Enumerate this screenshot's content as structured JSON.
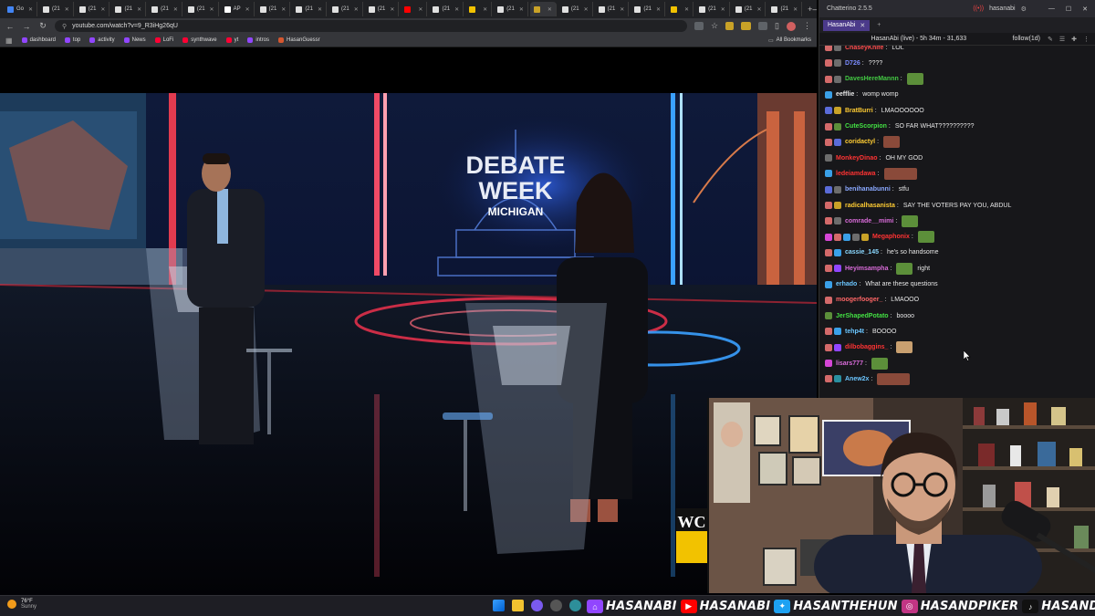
{
  "browser": {
    "tabs": [
      {
        "label": "Go",
        "color": "#4285f4"
      },
      {
        "label": "(21",
        "color": "#e0e0e0",
        "glyph": "X"
      },
      {
        "label": "(21",
        "color": "#e0e0e0",
        "glyph": "X"
      },
      {
        "label": "(21",
        "color": "#e0e0e0",
        "glyph": "X"
      },
      {
        "label": "(21",
        "color": "#e0e0e0",
        "glyph": "X"
      },
      {
        "label": "(21",
        "color": "#e0e0e0",
        "glyph": "X"
      },
      {
        "label": "AP",
        "color": "#ffffff",
        "glyph": "AP"
      },
      {
        "label": "(21",
        "color": "#e0e0e0",
        "glyph": "X"
      },
      {
        "label": "(21",
        "color": "#e0e0e0",
        "glyph": "X"
      },
      {
        "label": "(21",
        "color": "#e0e0e0",
        "glyph": "X"
      },
      {
        "label": "(21",
        "color": "#e0e0e0",
        "glyph": "X"
      },
      {
        "label": "",
        "color": "#ff0000",
        "glyph": "▶"
      },
      {
        "label": "(21",
        "color": "#e0e0e0",
        "glyph": "X"
      },
      {
        "label": "",
        "color": "#f2c200"
      },
      {
        "label": "(21",
        "color": "#e0e0e0",
        "glyph": "X"
      },
      {
        "label": "",
        "color": "#c9a227",
        "active": true
      },
      {
        "label": "(21",
        "color": "#e0e0e0",
        "glyph": "X"
      },
      {
        "label": "(21",
        "color": "#e0e0e0",
        "glyph": "X"
      },
      {
        "label": "(21",
        "color": "#e0e0e0",
        "glyph": "X"
      },
      {
        "label": "",
        "color": "#f2c200"
      },
      {
        "label": "(21",
        "color": "#e0e0e0",
        "glyph": "X"
      },
      {
        "label": "(21",
        "color": "#e0e0e0",
        "glyph": "X"
      },
      {
        "label": "(21",
        "color": "#e0e0e0",
        "glyph": "X"
      }
    ],
    "url": "youtube.com/watch?v=9_R3iHg26qU",
    "bookmarks": [
      {
        "label": "dashboard",
        "color": "#9146ff"
      },
      {
        "label": "top",
        "color": "#9146ff"
      },
      {
        "label": "activity",
        "color": "#9146ff"
      },
      {
        "label": "News",
        "color": "#9146ff"
      },
      {
        "label": "LoFi",
        "color": "#ff0033"
      },
      {
        "label": "synthwave",
        "color": "#ff0033"
      },
      {
        "label": "yt",
        "color": "#ff0033"
      },
      {
        "label": "intros",
        "color": "#9146ff"
      },
      {
        "label": "HasanGuessr",
        "color": "#d6572f"
      }
    ],
    "all_bookmarks": "All Bookmarks"
  },
  "video": {
    "headline_line1": "DEBATE",
    "headline_line2": "WEEK",
    "headline_state": "MICHIGAN",
    "watermark": "WC"
  },
  "chat": {
    "app_title": "Chatterino 2.5.5",
    "account": "hasanabi",
    "tab_label": "HasanAbi",
    "stream_info": "HasanAbi (live) - 5h 34m - 31,633",
    "follow": "follow(1d)",
    "messages": [
      {
        "user": "ChaseyKnife",
        "color": "#ff4d4d",
        "text": "LOL",
        "badges": [
          "#d46a6a",
          "#6d6d6d"
        ]
      },
      {
        "user": "D726",
        "color": "#7b8cff",
        "text": "????",
        "badges": [
          "#d46a6a",
          "#6d6d6d"
        ]
      },
      {
        "user": "DavesHereMannn",
        "color": "#43c943",
        "text": "",
        "badges": [
          "#d46a6a",
          "#6d6d6d"
        ],
        "emote": "#5c8f3a"
      },
      {
        "user": "eefflie",
        "color": "#e6e6e6",
        "text": "womp womp",
        "badges": [
          "#3aa0e8"
        ]
      },
      {
        "user": "BratBurri",
        "color": "#ffcc33",
        "text": "LMAOOOOOO",
        "badges": [
          "#5a6bd8",
          "#c9a227"
        ]
      },
      {
        "user": "CuteScorpion",
        "color": "#43e043",
        "text": "SO FAR WHAT??????????",
        "badges": [
          "#d46a6a",
          "#5c8f3a"
        ]
      },
      {
        "user": "coridactyl",
        "color": "#ffcc33",
        "text": "",
        "badges": [
          "#d46a6a",
          "#5a6bd8"
        ],
        "emote": "#8a4a3a"
      },
      {
        "user": "MonkeyDinao",
        "color": "#ff3333",
        "text": "OH MY GOD",
        "badges": [
          "#6d6d6d"
        ]
      },
      {
        "user": "ledeiamdawa",
        "color": "#ff3333",
        "text": "",
        "badges": [
          "#3aa0e8"
        ],
        "emote": "#8a4a3a",
        "emote_w": 36
      },
      {
        "user": "benihanabunni",
        "color": "#8aa8ff",
        "text": "stfu",
        "badges": [
          "#5a6bd8",
          "#6d6d6d"
        ]
      },
      {
        "user": "radicalhasanista",
        "color": "#ffcc33",
        "text": "SAY THE VOTERS PAY YOU, ABDUL",
        "badges": [
          "#d46a6a",
          "#c9a227"
        ]
      },
      {
        "user": "comrade__mimi",
        "color": "#d86bd8",
        "text": "",
        "badges": [
          "#d46a6a",
          "#6d6d6d"
        ],
        "emote": "#5c8f3a"
      },
      {
        "user": "Megaphonix",
        "color": "#ff3333",
        "text": "",
        "badges": [
          "#d646d6",
          "#d46a6a",
          "#3aa0e8",
          "#6d6d6d",
          "#c9a227"
        ],
        "emote": "#5c8f3a"
      },
      {
        "user": "cassie_145",
        "color": "#8ad8ff",
        "text": "he's so handsome",
        "badges": [
          "#d46a6a",
          "#3aa0e8"
        ]
      },
      {
        "user": "Heyimsampha",
        "color": "#d86bd8",
        "text": "right",
        "badges": [
          "#d46a6a",
          "#9146ff"
        ],
        "emote": "#5c8f3a",
        "emote_before_text": true
      },
      {
        "user": "erhado",
        "color": "#6bc6ff",
        "text": "What are these questions",
        "badges": [
          "#3aa0e8"
        ]
      },
      {
        "user": "moogerfooger_",
        "color": "#ff6666",
        "text": "LMAOOO",
        "badges": [
          "#d46a6a"
        ]
      },
      {
        "user": "JerShapedPotato",
        "color": "#43e043",
        "text": "boooo",
        "badges": [
          "#5c8f3a"
        ]
      },
      {
        "user": "tehp4t",
        "color": "#6bc6ff",
        "text": "BOOOO",
        "badges": [
          "#d46a6a",
          "#3aa0e8"
        ]
      },
      {
        "user": "dilbobaggins_",
        "color": "#ff3333",
        "text": "",
        "badges": [
          "#d46a6a",
          "#9146ff"
        ],
        "emote": "#c9a070"
      },
      {
        "user": "lisars777",
        "color": "#d86bd8",
        "text": "",
        "badges": [
          "#d646d6"
        ],
        "emote": "#5c8f3a"
      },
      {
        "user": "Anew2x",
        "color": "#6bc6ff",
        "text": "",
        "badges": [
          "#d46a6a",
          "#2a8fa0"
        ],
        "emote": "#8a4a3a",
        "emote_w": 36
      }
    ]
  },
  "taskbar": {
    "temp": "76°F",
    "condition": "Sunny"
  },
  "socials": [
    {
      "platform": "twitch",
      "handle": "HASANABI",
      "color": "#9146ff"
    },
    {
      "platform": "youtube",
      "handle": "HASANABI",
      "color": "#ff0000"
    },
    {
      "platform": "twitter",
      "handle": "HASANTHEHUN",
      "color": "#1da1f2"
    },
    {
      "platform": "instagram",
      "handle": "HASANDPIKER",
      "color": "#c13584"
    },
    {
      "platform": "tiktok",
      "handle": "HASANDPIKER",
      "color": "#111111"
    }
  ]
}
